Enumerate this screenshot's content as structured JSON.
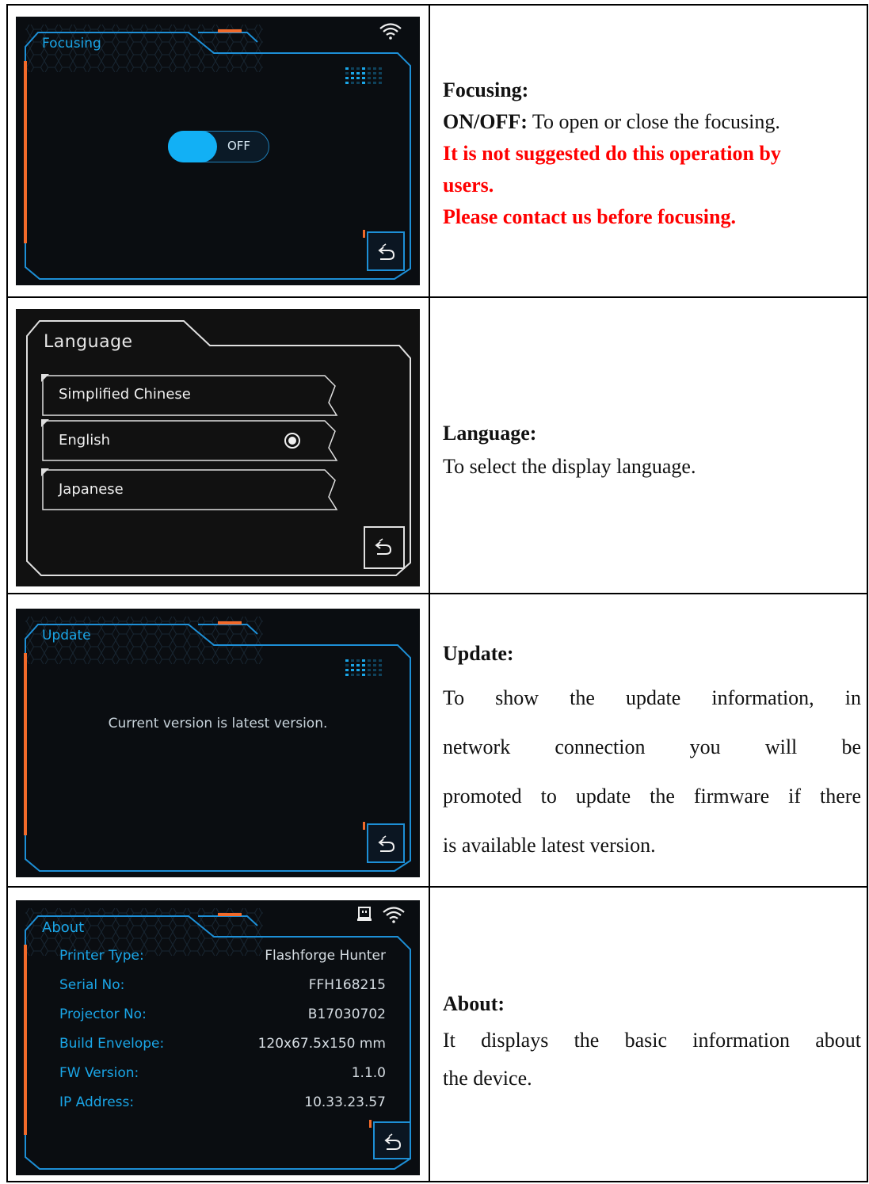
{
  "rows": [
    {
      "screen": {
        "title": "Focusing",
        "toggle_label": "OFF"
      },
      "heading": "Focusing:",
      "lines": [
        {
          "bold": "ON/OFF:",
          "text": " To open or close the focusing."
        }
      ],
      "warning_1a": "It is not suggested do this operation by",
      "warning_1b": "users.",
      "warning_2": "Please contact us before focusing."
    },
    {
      "screen": {
        "title": "Language",
        "options": [
          "Simplified Chinese",
          "English",
          "Japanese"
        ],
        "selected": "English"
      },
      "heading": "Language:",
      "description": "To select the display language."
    },
    {
      "screen": {
        "title": "Update",
        "message": "Current version is latest version."
      },
      "heading": "Update:",
      "description_lines": [
        "To show the update information, in",
        "network connection you will be",
        "promoted to update the firmware if there",
        "is available latest version."
      ]
    },
    {
      "screen": {
        "title": "About",
        "info": [
          {
            "key": "Printer Type:",
            "value": "Flashforge Hunter"
          },
          {
            "key": "Serial No:",
            "value": "FFH168215"
          },
          {
            "key": "Projector No:",
            "value": "B17030702"
          },
          {
            "key": "Build Envelope:",
            "value": "120x67.5x150 mm"
          },
          {
            "key": "FW Version:",
            "value": "1.1.0"
          },
          {
            "key": "IP Address:",
            "value": "10.33.23.57"
          }
        ]
      },
      "heading": "About:",
      "description_lines": [
        "It displays the basic information about",
        "the device."
      ]
    }
  ],
  "colors": {
    "accent_blue": "#1aa6e8",
    "accent_orange": "#f26a2a",
    "warning_red": "#ff0000"
  }
}
